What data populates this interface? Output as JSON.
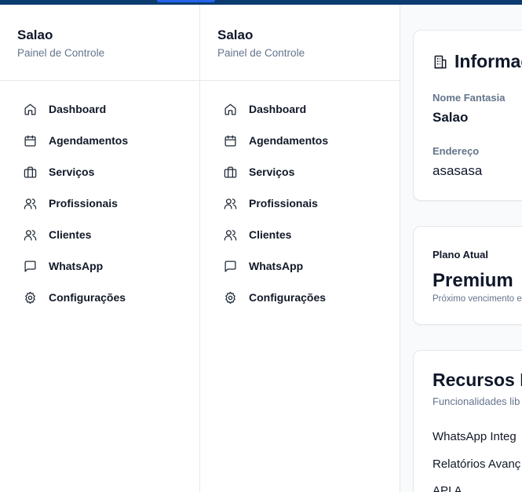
{
  "sidebar": {
    "title": "Salao",
    "subtitle": "Painel de Controle",
    "items": [
      {
        "label": "Dashboard",
        "icon": "home-icon"
      },
      {
        "label": "Agendamentos",
        "icon": "calendar-icon"
      },
      {
        "label": "Serviços",
        "icon": "briefcase-icon"
      },
      {
        "label": "Profissionais",
        "icon": "users-icon"
      },
      {
        "label": "Clientes",
        "icon": "users-icon"
      },
      {
        "label": "WhatsApp",
        "icon": "message-square-icon"
      },
      {
        "label": "Configurações",
        "icon": "settings-icon"
      }
    ]
  },
  "info_card": {
    "title": "Informac",
    "icon": "building-icon",
    "fields": [
      {
        "label": "Nome Fantasia",
        "value": "Salao"
      },
      {
        "label": "Endereço",
        "value": "asasasa"
      }
    ]
  },
  "plan_card": {
    "label": "Plano Atual",
    "name": "Premium",
    "next": "Próximo vencimento e"
  },
  "resources_card": {
    "title": "Recursos D",
    "subtitle": "Funcionalidades lib",
    "items": [
      "WhatsApp Integ",
      "Relatórios Avanç",
      "API A"
    ]
  },
  "colors": {
    "topbar": "#0b3b6f",
    "accent": "#2563eb",
    "muted_text": "#64748b",
    "border": "#e5e7eb"
  }
}
